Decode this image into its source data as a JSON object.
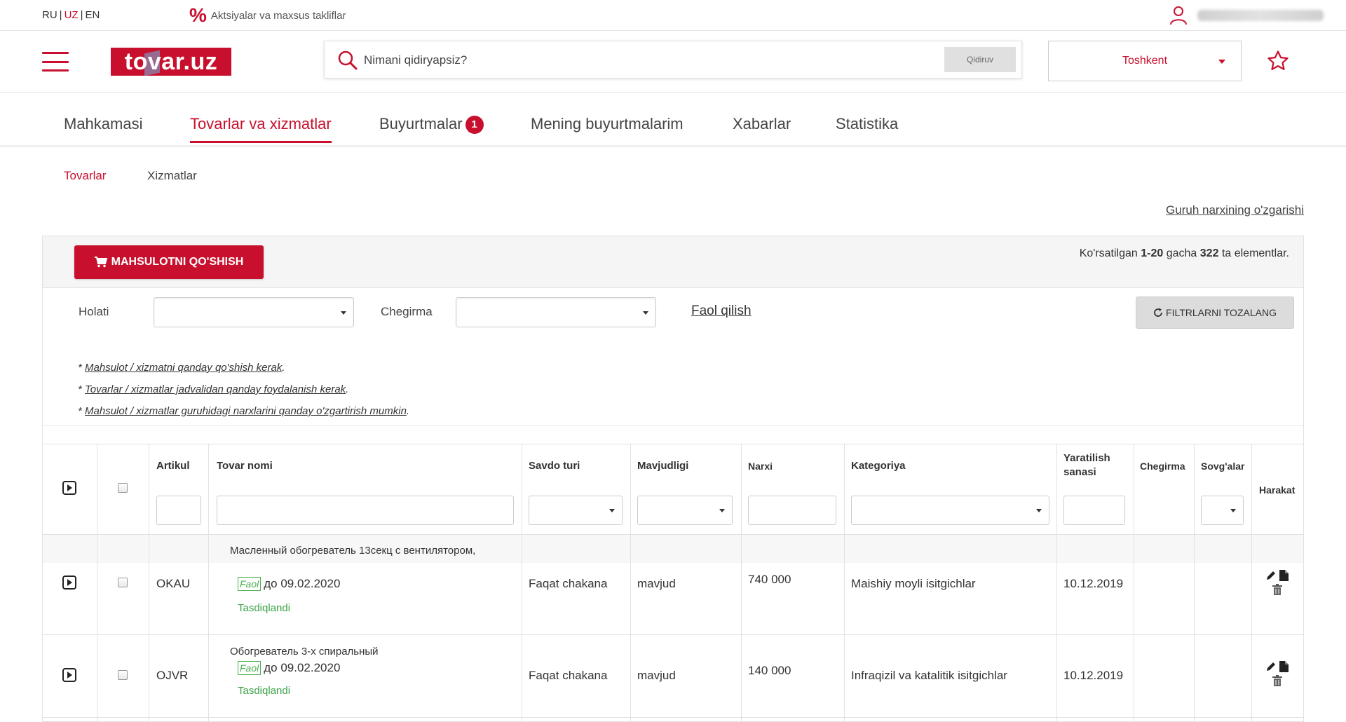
{
  "topbar": {
    "langs": [
      "RU",
      "UZ",
      "EN"
    ],
    "active_lang": "UZ",
    "promo_label": "Aktsiyalar va maxsus takliflar"
  },
  "header": {
    "logo_text": "tovar.uz",
    "search_placeholder": "Nimani qidiryapsiz?",
    "search_button": "Qidiruv",
    "city": "Toshkent"
  },
  "nav": {
    "items": [
      {
        "label": "Mahkamasi"
      },
      {
        "label": "Tovarlar va xizmatlar"
      },
      {
        "label": "Buyurtmalar",
        "badge": "1"
      },
      {
        "label": "Mening buyurtmalarim"
      },
      {
        "label": "Xabarlar"
      },
      {
        "label": "Statistika"
      }
    ],
    "active_index": 1
  },
  "subnav": {
    "tabs": [
      "Tovarlar",
      "Xizmatlar"
    ],
    "group_price_link": "Guruh narxining o'zgarishi"
  },
  "panel": {
    "add_button": "MAHSULOTNI QO'SHISH",
    "count_prefix": "Ko'rsatilgan",
    "count_range": "1-20",
    "count_mid": "gacha",
    "count_total": "322",
    "count_suffix": "ta elementlar.",
    "filters": {
      "status_label": "Holati",
      "discount_label": "Chegirma",
      "activate_link": "Faol qilish",
      "clear_button": "FILTRLARNI TOZALANG"
    },
    "help_links": [
      "Mahsulot / xizmatni qanday qo'shish kerak",
      "Tovarlar / xizmatlar jadvalidan qanday foydalanish kerak",
      "Mahsulot / xizmatlar guruhidagi narxlarini qanday o'zgartirish mumkin"
    ]
  },
  "table": {
    "headers": {
      "article": "Artikul",
      "name": "Tovar nomi",
      "trade_type": "Savdo turi",
      "availability": "Mavjudligi",
      "price": "Narxi",
      "category": "Kategoriya",
      "created_1": "Yaratilish",
      "created_2": "sanasi",
      "discount": "Chegirma",
      "gifts": "Sovg'alar",
      "action": "Harakat"
    },
    "rows": [
      {
        "name": "Масленный обогреватель 13секц с вентилятором,",
        "status_badge": "Faol",
        "status_until": "до 09.02.2020",
        "approval": "Tasdiqlandi",
        "article": "OKAU",
        "trade_type": "Faqat chakana",
        "availability": "mavjud",
        "price": "740 000",
        "category": "Maishiy moyli isitgichlar",
        "created": "10.12.2019"
      },
      {
        "name": "Обогреватель 3-х спиральный",
        "status_badge": "Faol",
        "status_until": "до 09.02.2020",
        "approval": "Tasdiqlandi",
        "article": "OJVR",
        "trade_type": "Faqat chakana",
        "availability": "mavjud",
        "price": "140 000",
        "category": "Infraqizil va katalitik isitgichlar",
        "created": "10.12.2019"
      }
    ]
  },
  "colors": {
    "brand": "#c8102e",
    "success": "#3aa346"
  }
}
